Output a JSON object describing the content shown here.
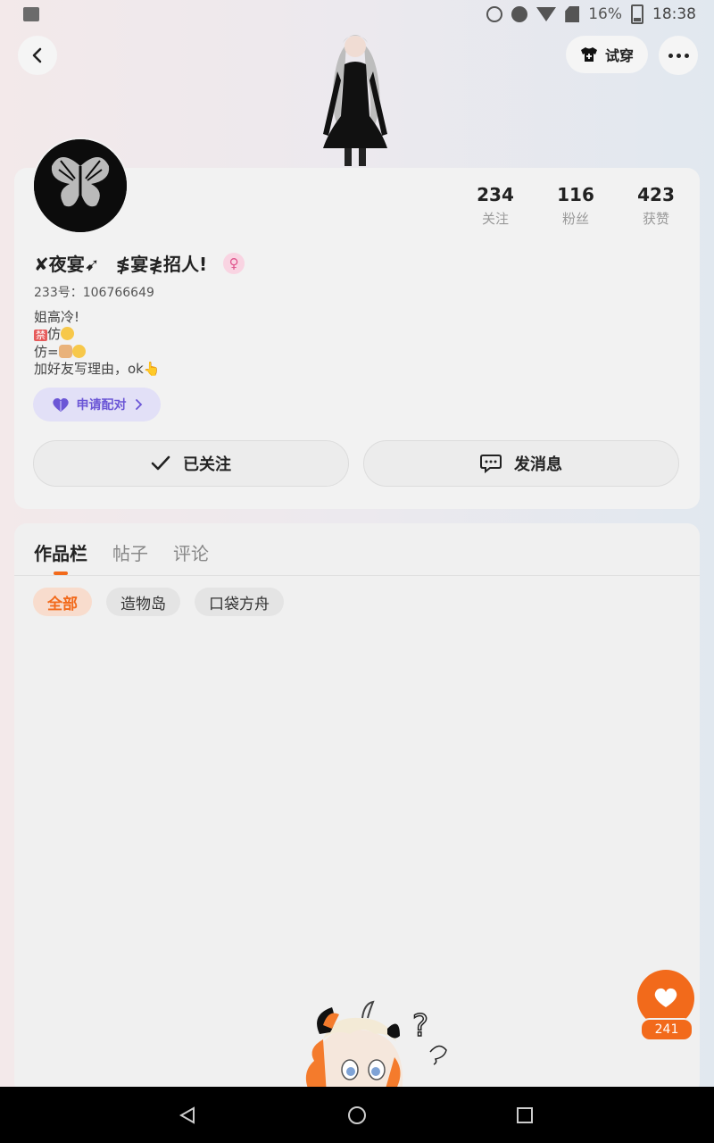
{
  "status_bar": {
    "battery": "16%",
    "time": "18:38"
  },
  "header": {
    "tryon_label": "试穿"
  },
  "profile": {
    "stats": [
      {
        "value": "234",
        "label": "关注"
      },
      {
        "value": "116",
        "label": "粉丝"
      },
      {
        "value": "423",
        "label": "获赞"
      }
    ],
    "name": "✘夜宴➹",
    "name_suffix": "≸宴≹招人!",
    "gender_symbol": "♀",
    "uid": "233号：106766649",
    "bio_lines": [
      "姐高冷!",
      "禁",
      "仿",
      "仿=",
      "加好友写理由，ok👆"
    ],
    "pair_label": "申请配对",
    "follow_label": "已关注",
    "message_label": "发消息"
  },
  "content": {
    "tabs": [
      "作品栏",
      "帖子",
      "评论"
    ],
    "filters": [
      "全部",
      "造物岛",
      "口袋方舟"
    ]
  },
  "like": {
    "count": "241"
  },
  "colors": {
    "accent": "#f26a1b",
    "pair": "#6b56d6",
    "gender": "#e0558d"
  }
}
